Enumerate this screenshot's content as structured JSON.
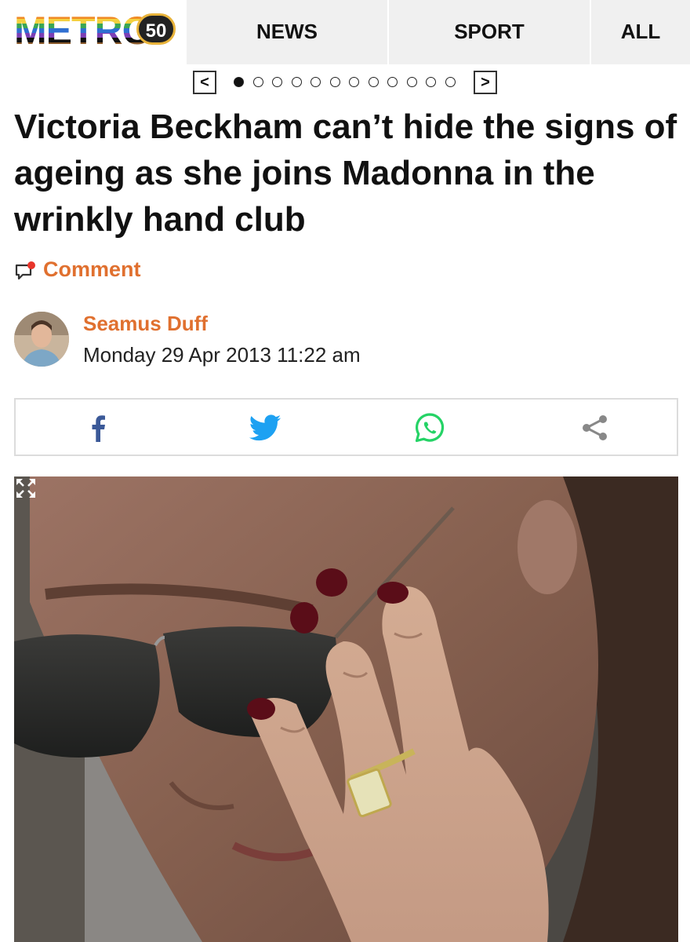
{
  "header": {
    "logo_text": "METRO",
    "logo_badge": "50",
    "nav": [
      {
        "label": "NEWS"
      },
      {
        "label": "SPORT"
      },
      {
        "label": "ALL"
      }
    ]
  },
  "carousel": {
    "prev_label": "<",
    "next_label": ">",
    "dot_count": 12,
    "active_index": 0
  },
  "article": {
    "headline": "Victoria Beckham can’t hide the signs of ageing as she joins Madonna in the wrinkly hand club",
    "comment_label": "Comment",
    "author": "Seamus Duff",
    "date": "Monday 29 Apr 2013 11:22 am"
  },
  "share": {
    "icons": [
      "facebook-icon",
      "twitter-icon",
      "whatsapp-icon",
      "share-icon"
    ],
    "colors": {
      "facebook": "#3b5998",
      "twitter": "#1da1f2",
      "whatsapp": "#25d366",
      "share": "#888888"
    }
  },
  "colors": {
    "accent": "#e0702f",
    "nav_bg": "#f0f0f0",
    "text": "#111111"
  },
  "hero": {
    "icon": "expand-icon"
  }
}
